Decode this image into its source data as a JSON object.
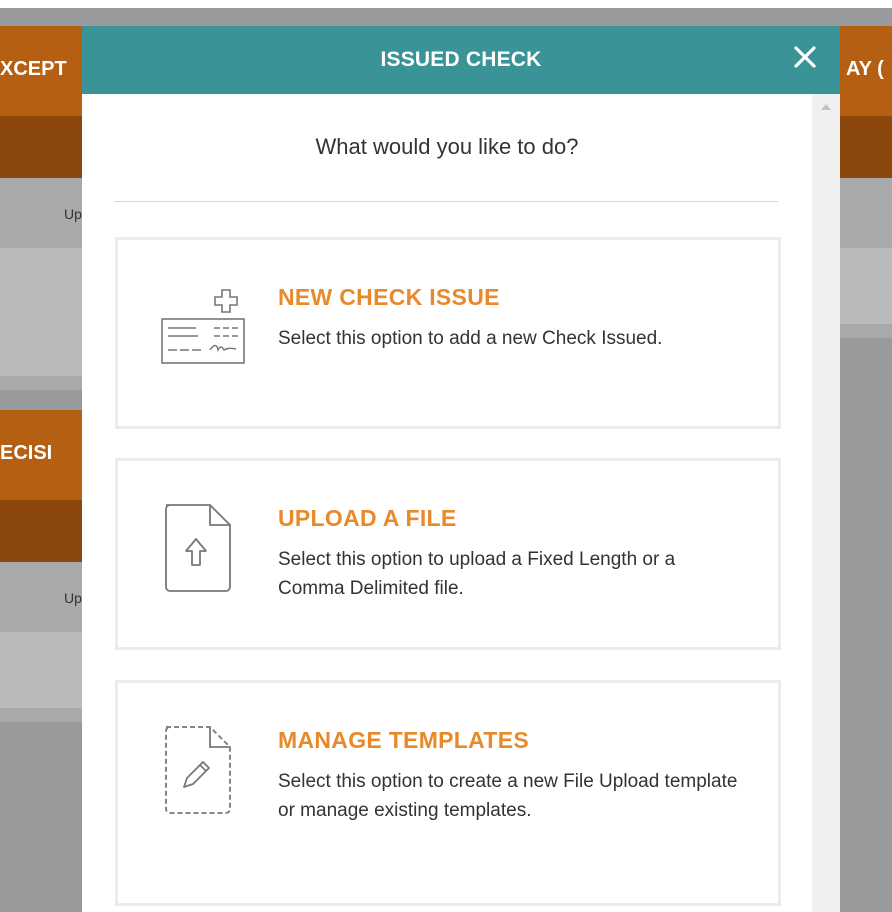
{
  "background": {
    "panel_left_top_title": "XCEPT",
    "panel_right_top_title": "AY (",
    "panel_left_mid_title": "ECISI",
    "row_text_1": "Up",
    "row_text_2": "Up"
  },
  "modal": {
    "title": "ISSUED CHECK",
    "prompt": "What would you like to do?",
    "options": [
      {
        "title": "NEW CHECK ISSUE",
        "description": "Select this option to add a new Check Issued.",
        "icon": "check-add-icon"
      },
      {
        "title": "UPLOAD A FILE",
        "description": "Select this option to upload a Fixed Length or a Comma Delimited file.",
        "icon": "file-upload-icon"
      },
      {
        "title": "MANAGE TEMPLATES",
        "description": "Select this option to create a new File Upload template or manage existing templates.",
        "icon": "template-edit-icon"
      }
    ]
  },
  "colors": {
    "header": "#3a9497",
    "accent": "#e8892a",
    "background_orange": "#b55f12"
  }
}
